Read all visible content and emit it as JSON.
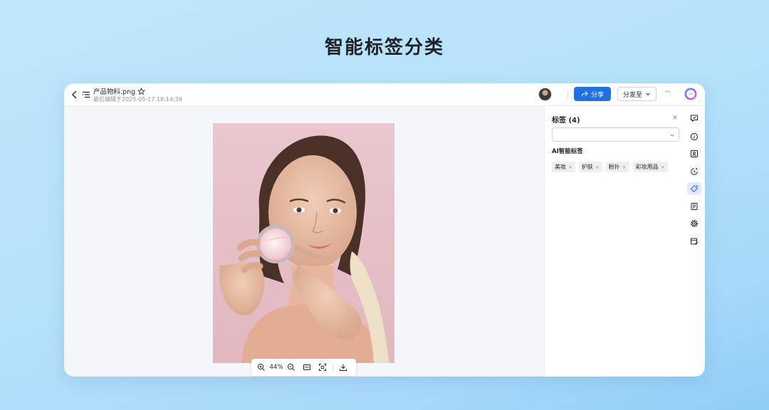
{
  "headline": "智能标签分类",
  "topbar": {
    "file_name": "产品物料.png",
    "last_edited": "最后编辑于2025-05-17 18:14:39",
    "share_label": "分享",
    "distribute_label": "分发至",
    "more_label": "···"
  },
  "viewer": {
    "zoom_level": "44%"
  },
  "tag_panel": {
    "title": "标签 (4)",
    "select_value": "",
    "ai_section_label": "AI智能标签",
    "tags": [
      {
        "label": "美妆"
      },
      {
        "label": "护肤"
      },
      {
        "label": "粉扑"
      },
      {
        "label": "彩妆用品"
      }
    ],
    "tag_remove_glyph": "×"
  },
  "colors": {
    "accent": "#1f6fe5",
    "active_rail_bg": "#e1eaff",
    "canvas_bg": "#f4f6f9",
    "photo_bg": "#e8c4cc"
  },
  "rail_icons": [
    "comment-icon",
    "info-icon",
    "image-info-icon",
    "history-icon",
    "tag-icon",
    "document-icon",
    "settings-icon",
    "task-icon"
  ]
}
